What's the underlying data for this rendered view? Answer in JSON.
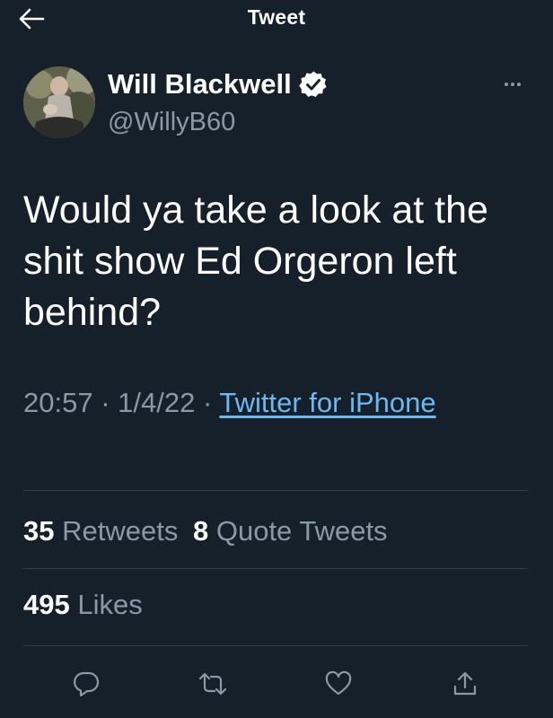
{
  "header": {
    "title": "Tweet",
    "back_icon": "back-arrow-icon"
  },
  "author": {
    "display_name": "Will Blackwell",
    "handle": "@WillyB60",
    "verified": true,
    "more_icon": "more-icon"
  },
  "tweet": {
    "text": "Would ya take a look at the shit show Ed Orgeron left behind?",
    "time": "20:57",
    "separator": "·",
    "date": "1/4/22",
    "source": "Twitter for iPhone"
  },
  "stats": {
    "retweets_count": "35",
    "retweets_label": "Retweets",
    "quotes_count": "8",
    "quotes_label": "Quote Tweets",
    "likes_count": "495",
    "likes_label": "Likes"
  },
  "actions": [
    "reply-icon",
    "retweet-icon",
    "like-icon",
    "share-icon"
  ],
  "colors": {
    "background": "#15202b",
    "text": "#ffffff",
    "secondary": "#8b98a5",
    "link": "#6cb8f0",
    "divider": "#2f3b47"
  }
}
